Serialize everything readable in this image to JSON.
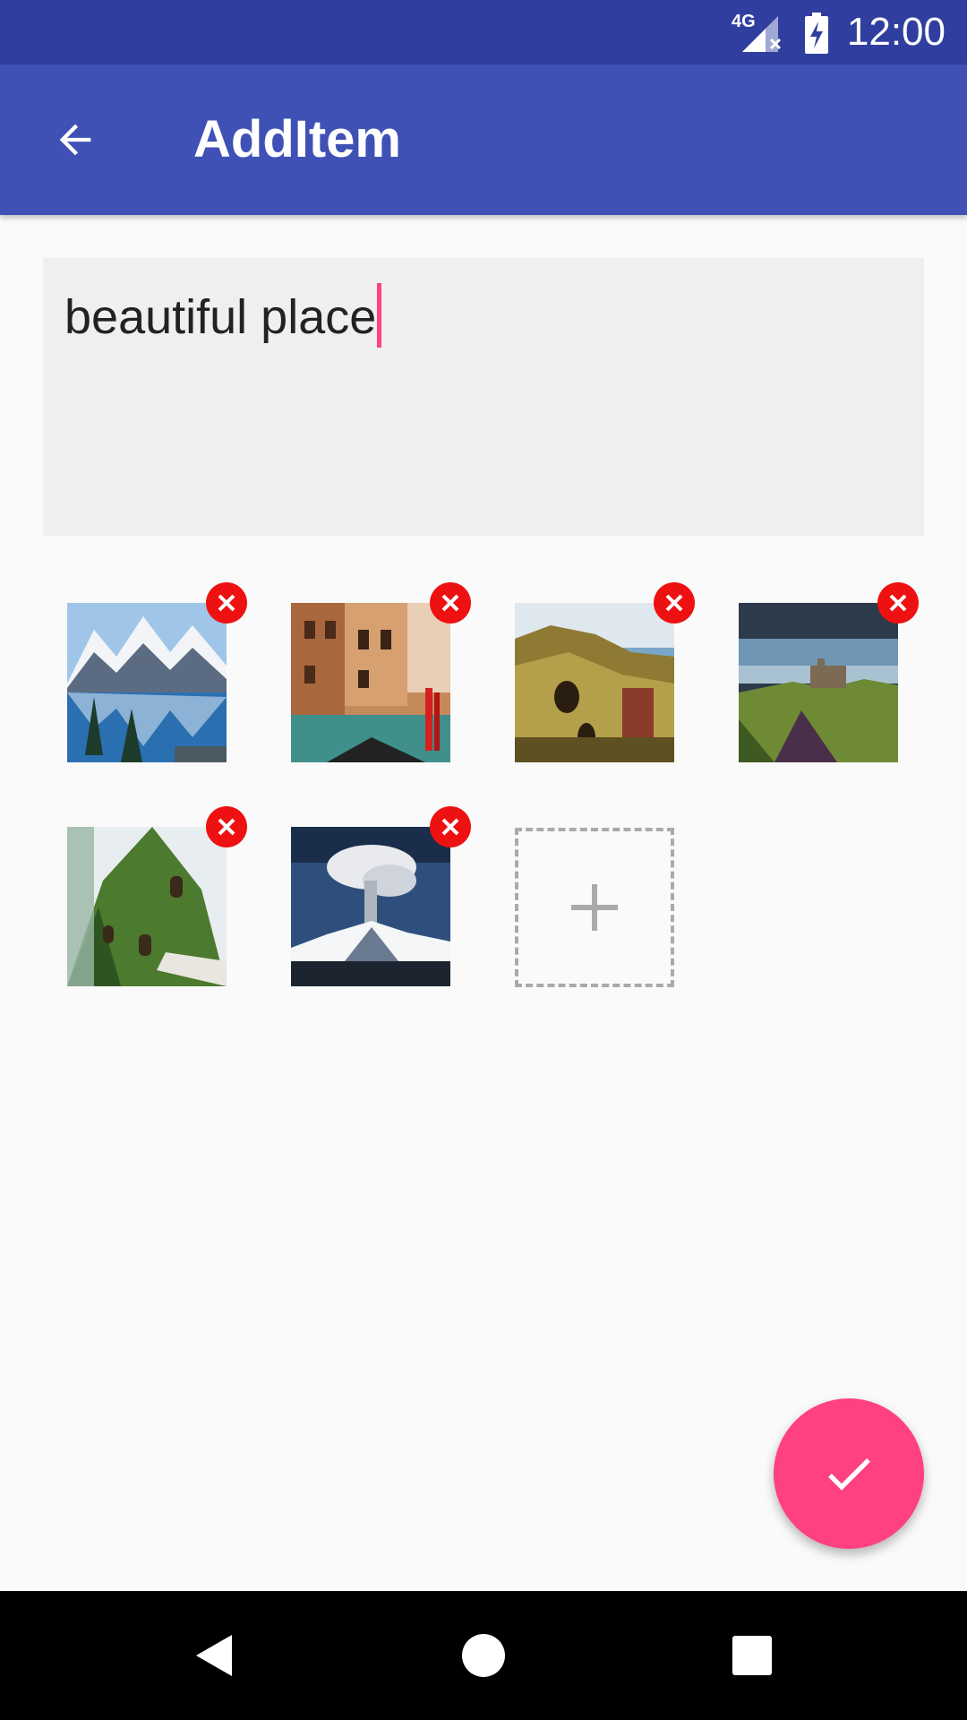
{
  "status_bar": {
    "time": "12:00",
    "network": "4G",
    "icons": [
      "signal-4g-icon",
      "battery-charging-icon"
    ]
  },
  "app_bar": {
    "title": "AddItem",
    "back_icon": "arrow-back-icon",
    "color": "#3f51b5",
    "status_color": "#303f9f"
  },
  "editor": {
    "value": "beautiful place",
    "cursor_color": "#ff4081"
  },
  "images": [
    {
      "name": "mountain-lake-photo",
      "remove_icon": "close-icon"
    },
    {
      "name": "venice-canal-photo",
      "remove_icon": "close-icon"
    },
    {
      "name": "cave-house-photo",
      "remove_icon": "close-icon"
    },
    {
      "name": "castle-landscape-photo",
      "remove_icon": "close-icon"
    },
    {
      "name": "moss-hotel-photo",
      "remove_icon": "close-icon"
    },
    {
      "name": "volcano-eruption-photo",
      "remove_icon": "close-icon"
    }
  ],
  "add_tile": {
    "icon": "plus-icon"
  },
  "fab": {
    "icon": "check-icon",
    "color": "#ff4081"
  },
  "nav_bar": {
    "icons": [
      "back-triangle-icon",
      "home-circle-icon",
      "recents-square-icon"
    ]
  }
}
